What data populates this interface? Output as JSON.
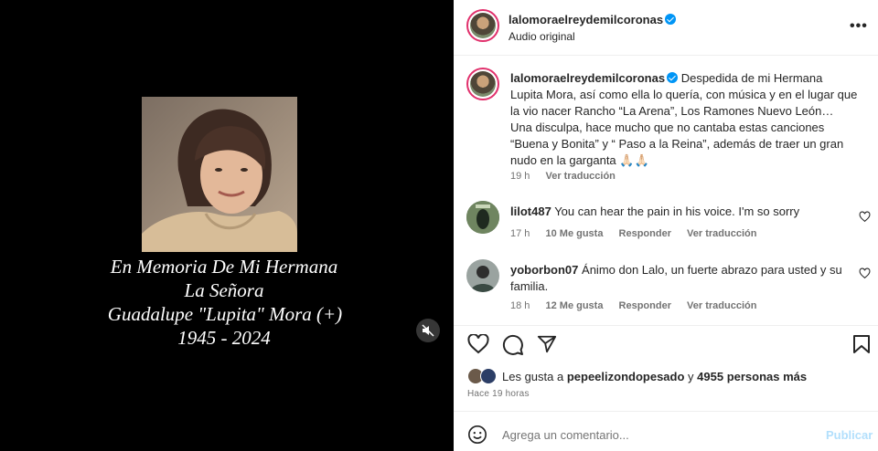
{
  "media": {
    "memorial_lines": [
      "En Memoria De Mi Hermana",
      "La Señora",
      "Guadalupe \"Lupita\" Mora (+)",
      "1945 - 2024"
    ]
  },
  "header": {
    "username": "lalomoraelreydemilcoronas",
    "audio": "Audio original",
    "more": "•••"
  },
  "caption": {
    "username": "lalomoraelreydemilcoronas",
    "text": "Despedida de mi Hermana Lupita Mora, así como ella lo quería, con música y en el lugar que la vio nacer Rancho “La Arena”, Los Ramones Nuevo León…",
    "text2": "Una disculpa, hace mucho que no cantaba estas canciones “Buena y Bonita” y “ Paso a la Reina”, además de traer un gran nudo en la garganta 🙏🏻🙏🏻",
    "time": "19 h",
    "translate": "Ver traducción"
  },
  "comments": [
    {
      "username": "lilot487",
      "text": "You can hear the pain in his voice. I'm so sorry",
      "time": "17 h",
      "likes": "10 Me gusta",
      "reply": "Responder",
      "translate": "Ver traducción"
    },
    {
      "username": "yoborbon07",
      "text": "Ánimo don Lalo, un fuerte abrazo para usted y su familia.",
      "time": "18 h",
      "likes": "12 Me gusta",
      "reply": "Responder",
      "translate": "Ver traducción"
    }
  ],
  "likes": {
    "prefix": "Les gusta a",
    "user": "pepeelizondopesado",
    "connector": "y",
    "count": "4955 personas más"
  },
  "posted": "Hace 19 horas",
  "comment_box": {
    "placeholder": "Agrega un comentario...",
    "publish": "Publicar"
  },
  "colors": {
    "link_blue": "#0095f6",
    "publish_disabled": "#b2dffc",
    "secondary_text": "#737373"
  }
}
